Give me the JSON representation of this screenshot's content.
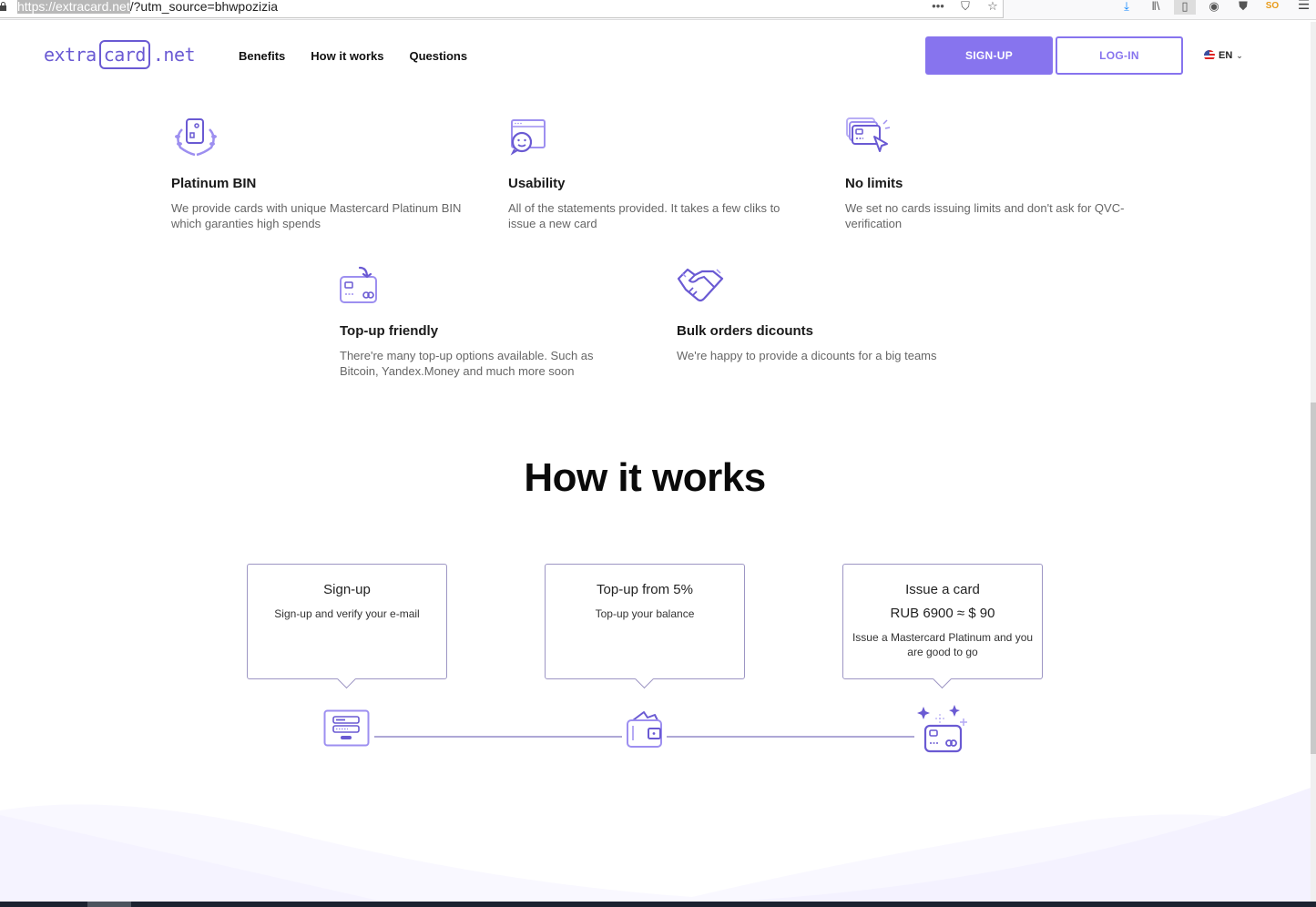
{
  "browser": {
    "url_selected": "https://extracard.net",
    "url_rest": "/?utm_source=bhwpozizia",
    "url_actions": [
      "more-icon",
      "pocket-icon",
      "bookmark-star-icon"
    ],
    "toolbar_icons": [
      "download-icon",
      "library-icon",
      "reader-view-icon",
      "account-icon",
      "shield-icon",
      "extension-icon"
    ],
    "extension_badge": "SO",
    "menu_icon": "hamburger-menu-icon"
  },
  "header": {
    "logo": {
      "prefix": "extra",
      "boxed": "card",
      "suffix": ".net"
    },
    "nav": [
      {
        "label": "Benefits"
      },
      {
        "label": "How it works"
      },
      {
        "label": "Questions"
      }
    ],
    "signup_label": "SIGN-UP",
    "login_label": "LOG-IN",
    "language": "EN"
  },
  "benefits": [
    {
      "icon": "laurel-card-icon",
      "title": "Platinum BIN",
      "text": "We provide cards with unique Mastercard Platinum BIN which garanties high spends"
    },
    {
      "icon": "smiley-window-icon",
      "title": "Usability",
      "text": "All of the statements provided. It takes a few cliks to issue a new card"
    },
    {
      "icon": "cards-cursor-icon",
      "title": "No limits",
      "text": "We set no cards issuing limits and don't ask for QVC-verification"
    },
    {
      "icon": "card-topup-icon",
      "title": "Top-up friendly",
      "text": "There're many top-up options available. Such as Bitcoin, Yandex.Money and much more soon"
    },
    {
      "icon": "handshake-icon",
      "title": "Bulk orders dicounts",
      "text": "We're happy to provide a dicounts for a big teams"
    }
  ],
  "how_it_works": {
    "title": "How it works",
    "steps": [
      {
        "title": "Sign-up",
        "price": "",
        "text": "Sign-up and verify your e-mail",
        "icon": "login-form-icon"
      },
      {
        "title": "Top-up from 5%",
        "price": "",
        "text": "Top-up your balance",
        "icon": "wallet-icon"
      },
      {
        "title": "Issue a card",
        "price": "RUB 6900 ≈ $ 90",
        "text": "Issue a Mastercard Platinum and you are good to go",
        "icon": "sparkle-card-icon"
      }
    ]
  },
  "colors": {
    "accent": "#8774ee",
    "icon_purple": "#6a5ad3",
    "line": "#aea8d6"
  }
}
